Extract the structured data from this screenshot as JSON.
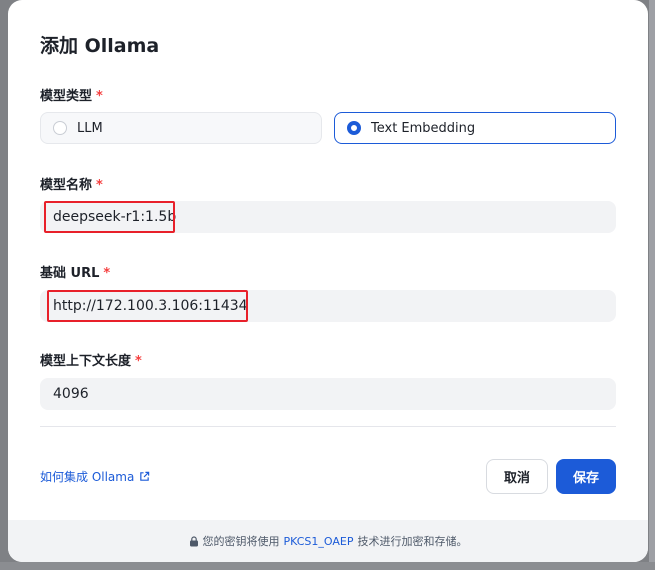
{
  "dialog": {
    "title": "添加 Ollama",
    "model_type": {
      "label": "模型类型",
      "required_mark": "*",
      "options": [
        {
          "label": "LLM",
          "selected": false
        },
        {
          "label": "Text Embedding",
          "selected": true
        }
      ]
    },
    "model_name": {
      "label": "模型名称",
      "required_mark": "*",
      "value": "deepseek-r1:1.5b"
    },
    "base_url": {
      "label": "基础 URL",
      "required_mark": "*",
      "value": "http://172.100.3.106:11434"
    },
    "context_length": {
      "label": "模型上下文长度",
      "required_mark": "*",
      "value": "4096"
    },
    "help_link": {
      "label": "如何集成 Ollama",
      "icon": "external-link-icon"
    },
    "buttons": {
      "cancel": "取消",
      "save": "保存"
    },
    "footer": {
      "icon": "lock-icon",
      "text_before": "您的密钥将使用",
      "algorithm": "PKCS1_OAEP",
      "text_after": "技术进行加密和存储。"
    }
  },
  "colors": {
    "accent": "#1c5bd8",
    "required": "#f53f3f",
    "annotation_box": "#e8202a",
    "input_bg": "#f2f3f5"
  }
}
